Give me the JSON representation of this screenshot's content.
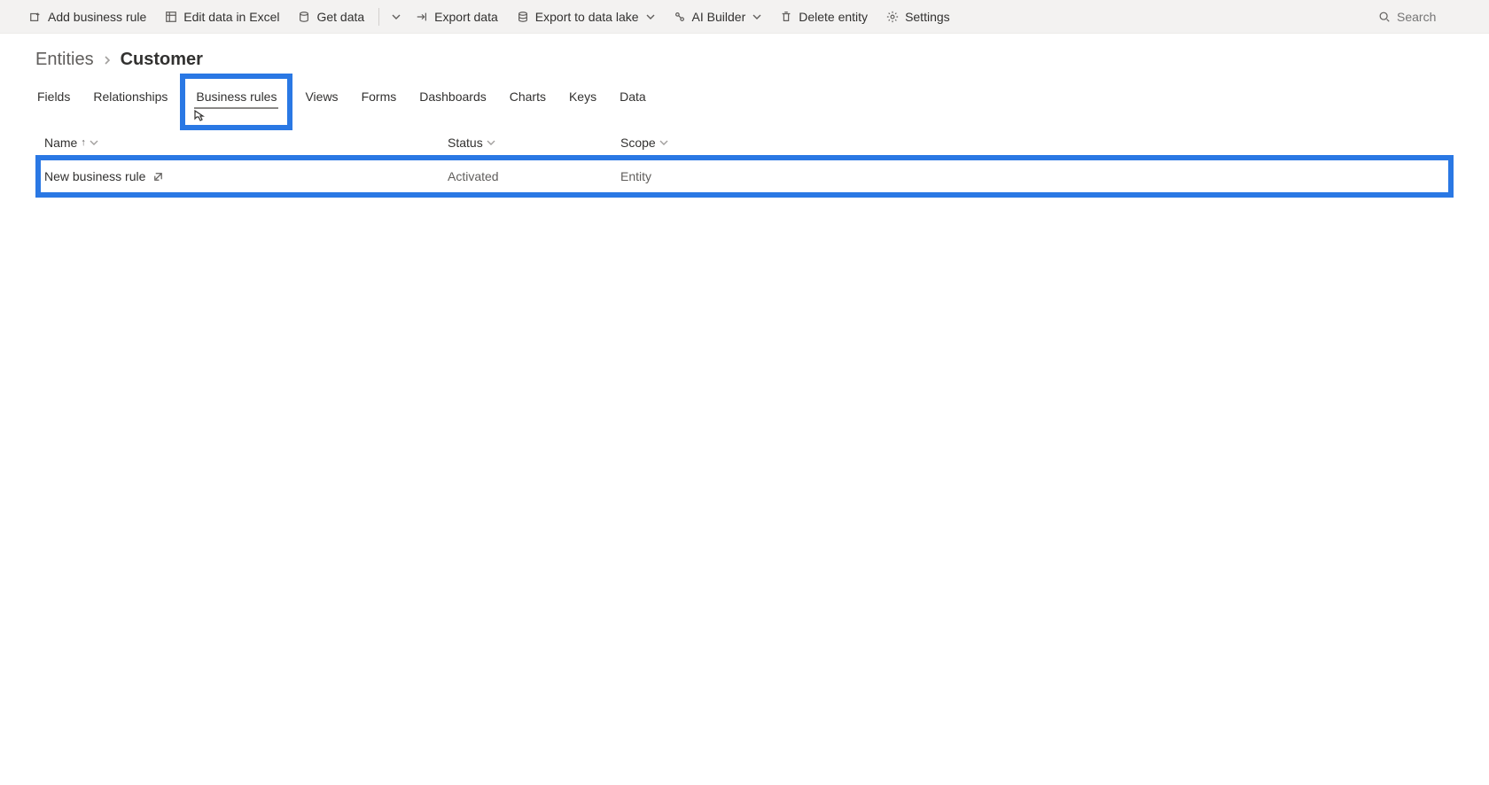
{
  "commands": {
    "add_business_rule": "Add business rule",
    "edit_in_excel": "Edit data in Excel",
    "get_data": "Get data",
    "export_data": "Export data",
    "export_data_lake": "Export to data lake",
    "ai_builder": "AI Builder",
    "delete_entity": "Delete entity",
    "settings": "Settings"
  },
  "search": {
    "placeholder": "Search"
  },
  "breadcrumb": {
    "root": "Entities",
    "current": "Customer"
  },
  "tabs": {
    "fields": "Fields",
    "relationships": "Relationships",
    "business_rules": "Business rules",
    "views": "Views",
    "forms": "Forms",
    "dashboards": "Dashboards",
    "charts": "Charts",
    "keys": "Keys",
    "data": "Data"
  },
  "grid": {
    "headers": {
      "name": "Name",
      "status": "Status",
      "scope": "Scope"
    },
    "rows": [
      {
        "name": "New business rule",
        "status": "Activated",
        "scope": "Entity"
      }
    ]
  }
}
